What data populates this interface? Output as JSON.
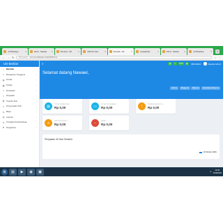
{
  "browser": {
    "tabs": [
      {
        "label": "(1) WhatsApp"
      },
      {
        "label": "Admin - Nawawi"
      },
      {
        "label": "Bersama - UD"
      },
      {
        "label": "Ubah Per Hari"
      },
      {
        "label": "Beranda - UD",
        "active": true
      },
      {
        "label": "penjualanber"
      },
      {
        "label": "Admin - Nawaw"
      },
      {
        "label": "(1) WhatsApp"
      }
    ],
    "url_security": "Not secure",
    "url": "pos.opmusikasan.net/public/home"
  },
  "sidebar": {
    "brand": "UD Berlian",
    "items": [
      {
        "label": "Beranda",
        "icon": "home-icon",
        "active": true,
        "caret": false
      },
      {
        "label": "Manajemen Pengguna",
        "icon": "users-icon",
        "caret": true
      },
      {
        "label": "Kontak",
        "icon": "address-book-icon",
        "caret": true
      },
      {
        "label": "Produk",
        "icon": "box-icon",
        "caret": true
      },
      {
        "label": "Pembelian",
        "icon": "cart-in-icon",
        "caret": true
      },
      {
        "label": "Penjualan",
        "icon": "cart-out-icon",
        "caret": true
      },
      {
        "label": "Transfer Stok",
        "icon": "transfer-icon",
        "caret": true
      },
      {
        "label": "Penyesuaian Stok",
        "icon": "adjust-icon",
        "caret": true
      },
      {
        "label": "Biaya",
        "icon": "money-icon",
        "caret": true
      },
      {
        "label": "Laporan",
        "icon": "chart-icon",
        "caret": true
      },
      {
        "label": "Template Pemberitahuan",
        "icon": "envelope-icon",
        "caret": false
      },
      {
        "label": "Pengaturan",
        "icon": "gear-icon",
        "caret": true
      }
    ]
  },
  "topbar": {
    "pos_label": "POS",
    "date": "08/10/2022",
    "user": "Nawawi Admin"
  },
  "main": {
    "welcome": "Selamat datang Nawawi,",
    "filters": [
      "Hari Ini",
      "Minggu Ini",
      "Bulan Ini",
      "Pembukuan Tahun Ini"
    ],
    "cards": [
      {
        "title": "TOTAL PEMBELIAN",
        "value": "Rp 0,00",
        "color": "#1ab3e8",
        "icon": "cart-icon"
      },
      {
        "title": "TOTAL PENJUALAN",
        "value": "Rp 0,00",
        "color": "#1ab3e8",
        "icon": "invoice-icon"
      },
      {
        "title": "PEMBELIAN JATUH...",
        "value": "Rp 0,00",
        "color": "#f39c12",
        "icon": "alert-icon"
      },
      {
        "title": "FAKTUR JATUH T...",
        "value": "Rp 0,00",
        "color": "#f39c12",
        "icon": "warning-icon"
      },
      {
        "title": "BIAYA",
        "value": "Rp 0,00",
        "color": "#dd4b39",
        "icon": "minus-circle-icon"
      }
    ],
    "panel_title": "Penjualan 30 Hari Terakhir",
    "legend_label": "UD Berlian (IDR)"
  },
  "taskbar": {
    "time": "10:49",
    "date": "12/08/2022"
  }
}
